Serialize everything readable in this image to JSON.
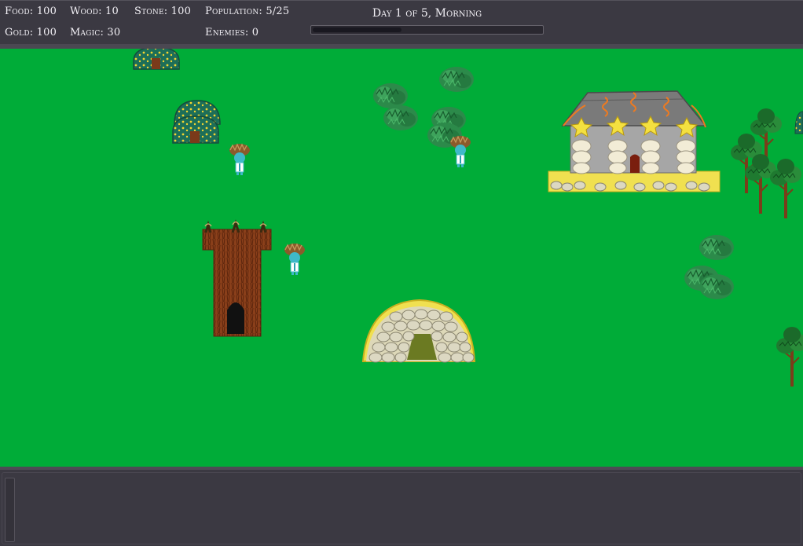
{
  "resources": {
    "food": "Food: 100",
    "wood": "Wood: 10",
    "stone": "Stone: 100",
    "population": "Population: 5/25",
    "gold": "Gold: 100",
    "magic": "Magic: 30",
    "enemies": "Enemies: 0"
  },
  "day": {
    "label": "Day 1 of 5, Morning",
    "progress": 0.39
  },
  "colors": {
    "grass": "#00ac38",
    "panel": "#3b3942",
    "text": "#f2f0f5"
  },
  "map": {
    "buildings": [
      {
        "type": "mushroom-hut"
      },
      {
        "type": "mushroom-hut"
      },
      {
        "type": "tree-tower"
      },
      {
        "type": "stone-burrow"
      },
      {
        "type": "star-temple"
      }
    ],
    "villagers": 3,
    "bushes": 7,
    "trees": 3
  }
}
